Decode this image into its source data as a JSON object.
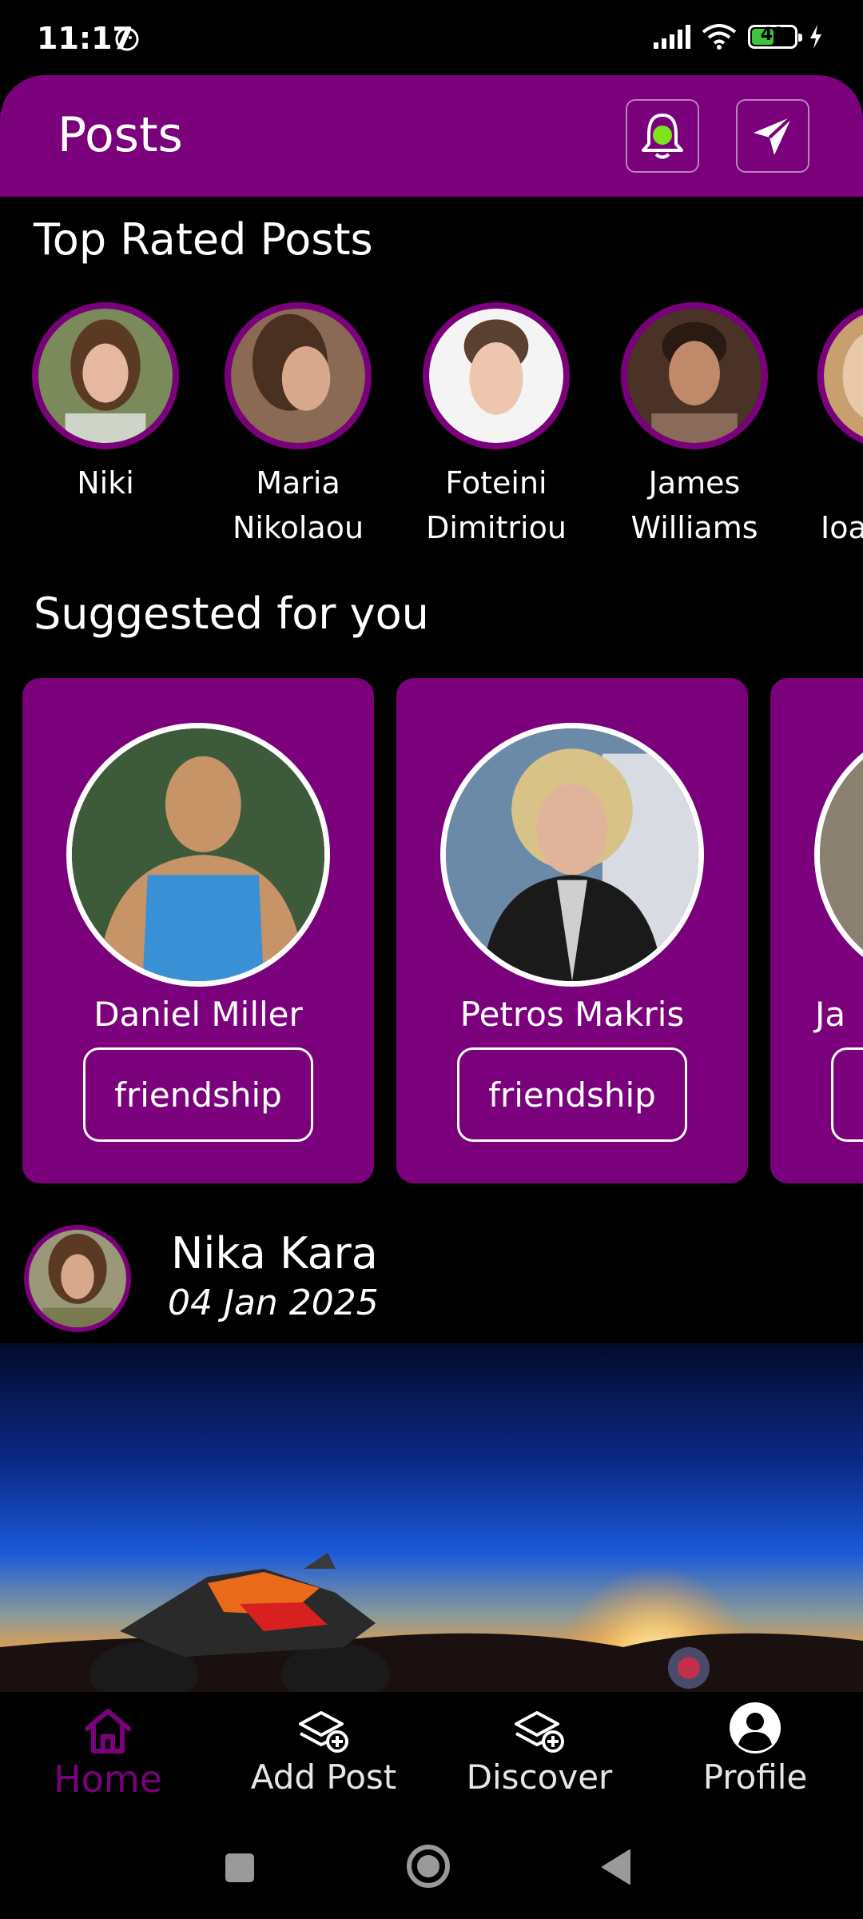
{
  "status_bar": {
    "time": "11:17",
    "battery": "49"
  },
  "header": {
    "title": "Posts"
  },
  "top_rated": {
    "title": "Top Rated Posts",
    "users": [
      {
        "name": "Niki"
      },
      {
        "name": "Maria Nikolaou"
      },
      {
        "name": "Foteini Dimitriou"
      },
      {
        "name": "James Williams"
      },
      {
        "name": "Ioa"
      }
    ]
  },
  "suggested": {
    "title": "Suggested for you",
    "cards": [
      {
        "name": "Daniel Miller",
        "tag": "friendship"
      },
      {
        "name": "Petros Makris",
        "tag": "friendship"
      },
      {
        "name": "Ja",
        "tag": ""
      }
    ]
  },
  "post": {
    "author": "Nika Kara",
    "date": "04 Jan 2025"
  },
  "nav": {
    "home": "Home",
    "add_post": "Add Post",
    "discover": "Discover",
    "profile": "Profile"
  },
  "colors": {
    "brand": "#7b007c",
    "notification_dot": "#7fe21b",
    "background": "#000000"
  }
}
